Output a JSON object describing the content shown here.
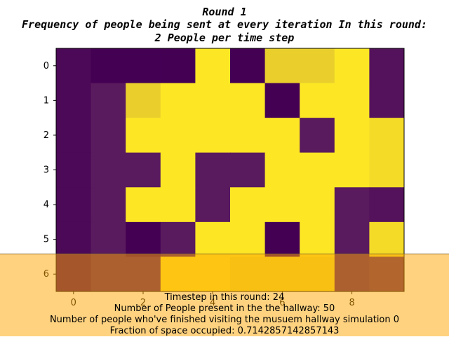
{
  "chart_data": {
    "type": "heatmap",
    "title_lines": [
      "Round 1",
      "Frequency of people being sent at every iteration In this round:",
      "2 People per time step"
    ],
    "rows": [
      0,
      1,
      2,
      3,
      4,
      5,
      6
    ],
    "cols": [
      0,
      1,
      2,
      3,
      4,
      5,
      6,
      7,
      8,
      9
    ],
    "x_ticks": [
      "0",
      "2",
      "4",
      "6",
      "8"
    ],
    "y_ticks": [
      "0",
      "1",
      "2",
      "3",
      "4",
      "5",
      "6"
    ],
    "colormap": "viridis",
    "values": [
      [
        0.05,
        0.0,
        0.0,
        0.0,
        1.0,
        0.0,
        0.9,
        0.9,
        1.0,
        0.1
      ],
      [
        0.05,
        0.15,
        0.9,
        1.0,
        1.0,
        1.0,
        0.0,
        1.0,
        1.0,
        0.1
      ],
      [
        0.05,
        0.15,
        1.0,
        1.0,
        1.0,
        1.0,
        1.0,
        0.15,
        1.0,
        0.95
      ],
      [
        0.05,
        0.15,
        0.15,
        1.0,
        0.15,
        0.15,
        1.0,
        1.0,
        1.0,
        0.95
      ],
      [
        0.05,
        0.15,
        1.0,
        1.0,
        0.15,
        1.0,
        1.0,
        1.0,
        0.15,
        0.1
      ],
      [
        0.05,
        0.15,
        0.0,
        0.15,
        1.0,
        1.0,
        0.0,
        1.0,
        0.15,
        0.95
      ],
      [
        0.05,
        0.15,
        0.15,
        1.0,
        1.0,
        0.95,
        0.95,
        0.95,
        0.15,
        0.2
      ]
    ],
    "colors": {
      "low": "#440154",
      "mid": "#5a1a5e",
      "high": "#fde725"
    }
  },
  "info": {
    "overlay_color": "#ffa500",
    "lines": [
      "Timestep in this round: 24",
      "Number of People present in the the hallway: 50",
      "Number of people who've finished visiting the musuem hallway simulation 0",
      "Fraction of space occupied: 0.7142857142857143"
    ]
  }
}
